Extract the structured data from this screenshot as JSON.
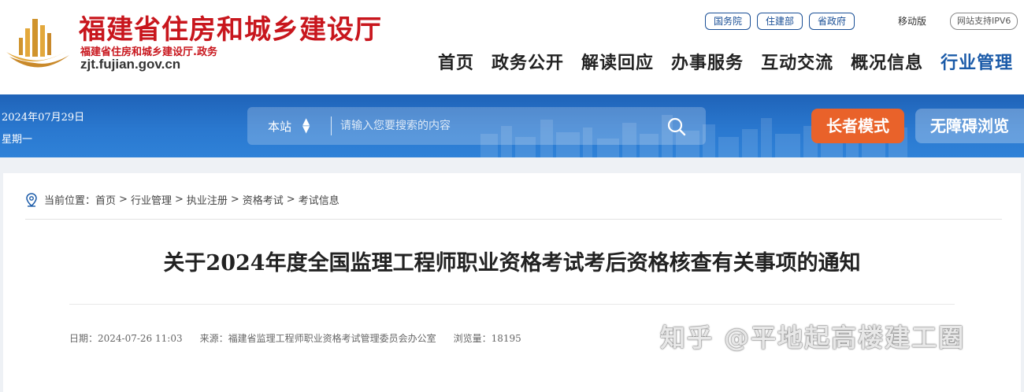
{
  "header": {
    "site_title": "福建省住房和城乡建设厅",
    "site_subtitle": "福建省住房和城乡建设厅.政务",
    "domain": "zjt.fujian.gov.cn",
    "top_links": [
      "国务院",
      "住建部",
      "省政府"
    ],
    "mobile_label": "移动版",
    "ipv6_label": "网站支持IPV6",
    "nav": [
      "首页",
      "政务公开",
      "解读回应",
      "办事服务",
      "互动交流",
      "概况信息",
      "行业管理"
    ],
    "nav_active": "行业管理"
  },
  "banner": {
    "date": "2024年07月29日",
    "weekday": "星期一",
    "search_scope": "本站",
    "search_placeholder": "请输入您要搜索的内容",
    "elder_mode": "长者模式",
    "accessibility": "无障碍浏览"
  },
  "breadcrumb": {
    "label": "当前位置：",
    "items": [
      "首页",
      "行业管理",
      "执业注册",
      "资格考试",
      "考试信息"
    ]
  },
  "article": {
    "title": "关于2024年度全国监理工程师职业资格考试考后资格核查有关事项的通知",
    "date": "日期：2024-07-26 11:03",
    "source": "来源：福建省监理工程师职业资格考试管理委员会办公室",
    "views": "浏览量：18195"
  },
  "watermark": "知乎 @平地起高楼建工圈",
  "colors": {
    "brand_red": "#c8161d",
    "nav_active": "#1a5aa8",
    "banner_blue": "#2a78cf",
    "elder_orange": "#e9622a"
  }
}
